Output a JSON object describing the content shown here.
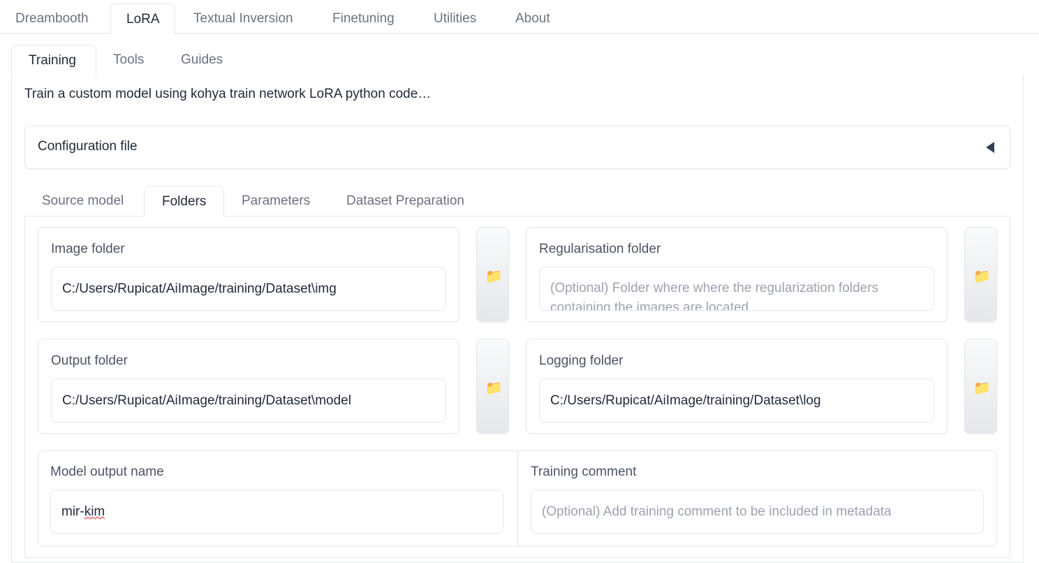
{
  "top_tabs": [
    "Dreambooth",
    "LoRA",
    "Textual Inversion",
    "Finetuning",
    "Utilities",
    "About"
  ],
  "active_top_tab": "LoRA",
  "sub_tabs": [
    "Training",
    "Tools",
    "Guides"
  ],
  "active_sub_tab": "Training",
  "description": "Train a custom model using kohya train network LoRA python code…",
  "config_accordion": {
    "label": "Configuration file"
  },
  "model_tabs": [
    "Source model",
    "Folders",
    "Parameters",
    "Dataset Preparation"
  ],
  "active_model_tab": "Folders",
  "folders": {
    "image": {
      "label": "Image folder",
      "value": "C:/Users/Rupicat/AiImage/training/Dataset\\img"
    },
    "reg": {
      "label": "Regularisation folder",
      "placeholder": "(Optional) Folder where where the regularization folders containing the images are located"
    },
    "output": {
      "label": "Output folder",
      "value": "C:/Users/Rupicat/AiImage/training/Dataset\\model"
    },
    "logging": {
      "label": "Logging folder",
      "value": "C:/Users/Rupicat/AiImage/training/Dataset\\log"
    },
    "folder_icon": "folder-icon"
  },
  "model_output": {
    "label": "Model output name",
    "value_part1": "mir-",
    "value_part2": "kim"
  },
  "training_comment": {
    "label": "Training comment",
    "placeholder": "(Optional) Add training comment to be included in metadata"
  },
  "colors": {
    "folder_icon": "#f5b800",
    "spell_underline": "#dc2626"
  }
}
